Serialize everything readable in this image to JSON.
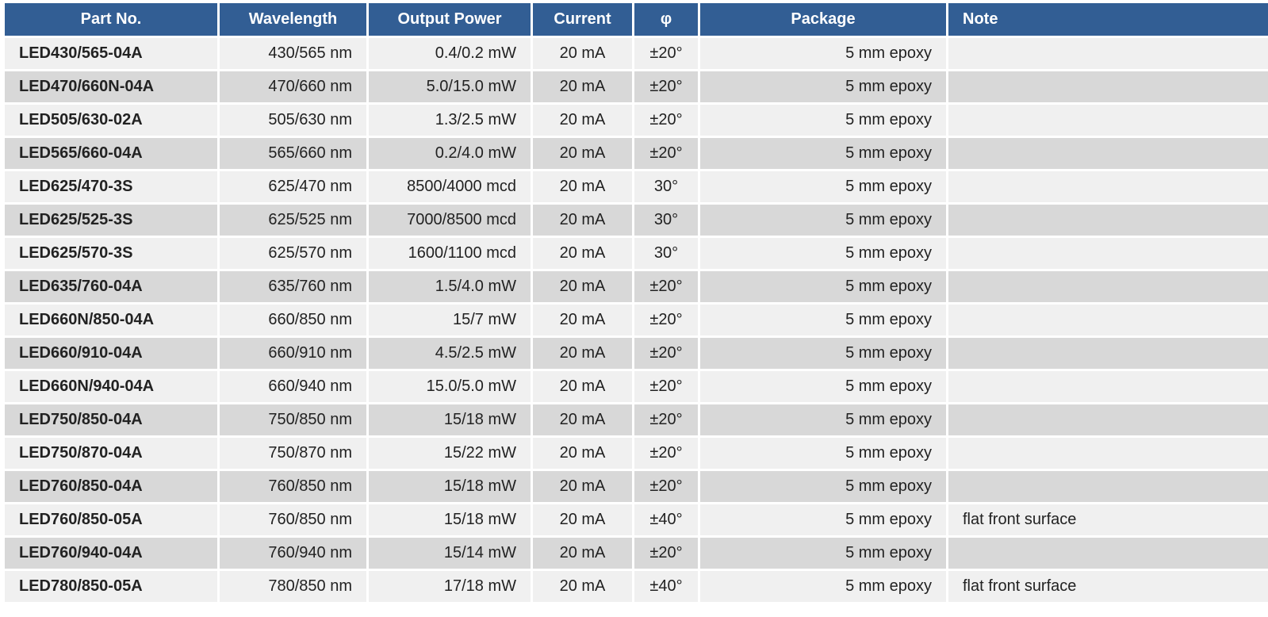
{
  "table": {
    "headers": {
      "part": "Part No.",
      "wavelength": "Wavelength",
      "output_power": "Output Power",
      "current": "Current",
      "phi": "φ",
      "package": "Package",
      "note": "Note"
    },
    "rows": [
      {
        "part": "LED430/565-04A",
        "wavelength": "430/565 nm",
        "output_power": "0.4/0.2 mW",
        "current": "20 mA",
        "phi": "±20°",
        "package": "5 mm epoxy",
        "note": ""
      },
      {
        "part": "LED470/660N-04A",
        "wavelength": "470/660 nm",
        "output_power": "5.0/15.0 mW",
        "current": "20 mA",
        "phi": "±20°",
        "package": "5 mm epoxy",
        "note": ""
      },
      {
        "part": "LED505/630-02A",
        "wavelength": "505/630 nm",
        "output_power": "1.3/2.5 mW",
        "current": "20 mA",
        "phi": "±20°",
        "package": "5 mm epoxy",
        "note": ""
      },
      {
        "part": "LED565/660-04A",
        "wavelength": "565/660 nm",
        "output_power": "0.2/4.0 mW",
        "current": "20 mA",
        "phi": "±20°",
        "package": "5 mm epoxy",
        "note": ""
      },
      {
        "part": "LED625/470-3S",
        "wavelength": "625/470 nm",
        "output_power": "8500/4000 mcd",
        "current": "20 mA",
        "phi": "30°",
        "package": "5 mm epoxy",
        "note": ""
      },
      {
        "part": "LED625/525-3S",
        "wavelength": "625/525 nm",
        "output_power": "7000/8500 mcd",
        "current": "20 mA",
        "phi": "30°",
        "package": "5 mm epoxy",
        "note": ""
      },
      {
        "part": "LED625/570-3S",
        "wavelength": "625/570 nm",
        "output_power": "1600/1100 mcd",
        "current": "20 mA",
        "phi": "30°",
        "package": "5 mm epoxy",
        "note": ""
      },
      {
        "part": "LED635/760-04A",
        "wavelength": "635/760 nm",
        "output_power": "1.5/4.0 mW",
        "current": "20 mA",
        "phi": "±20°",
        "package": "5 mm epoxy",
        "note": ""
      },
      {
        "part": "LED660N/850-04A",
        "wavelength": "660/850 nm",
        "output_power": "15/7 mW",
        "current": "20 mA",
        "phi": "±20°",
        "package": "5 mm epoxy",
        "note": ""
      },
      {
        "part": "LED660/910-04A",
        "wavelength": "660/910 nm",
        "output_power": "4.5/2.5 mW",
        "current": "20 mA",
        "phi": "±20°",
        "package": "5 mm epoxy",
        "note": ""
      },
      {
        "part": "LED660N/940-04A",
        "wavelength": "660/940 nm",
        "output_power": "15.0/5.0 mW",
        "current": "20 mA",
        "phi": "±20°",
        "package": "5 mm epoxy",
        "note": ""
      },
      {
        "part": "LED750/850-04A",
        "wavelength": "750/850 nm",
        "output_power": "15/18 mW",
        "current": "20 mA",
        "phi": "±20°",
        "package": "5 mm epoxy",
        "note": ""
      },
      {
        "part": "LED750/870-04A",
        "wavelength": "750/870 nm",
        "output_power": "15/22 mW",
        "current": "20 mA",
        "phi": "±20°",
        "package": "5 mm epoxy",
        "note": ""
      },
      {
        "part": "LED760/850-04A",
        "wavelength": "760/850 nm",
        "output_power": "15/18 mW",
        "current": "20 mA",
        "phi": "±20°",
        "package": "5 mm epoxy",
        "note": ""
      },
      {
        "part": "LED760/850-05A",
        "wavelength": "760/850 nm",
        "output_power": "15/18 mW",
        "current": "20 mA",
        "phi": "±40°",
        "package": "5 mm epoxy",
        "note": "flat front surface"
      },
      {
        "part": "LED760/940-04A",
        "wavelength": "760/940 nm",
        "output_power": "15/14 mW",
        "current": "20 mA",
        "phi": "±20°",
        "package": "5 mm epoxy",
        "note": ""
      },
      {
        "part": "LED780/850-05A",
        "wavelength": "780/850 nm",
        "output_power": "17/18 mW",
        "current": "20 mA",
        "phi": "±40°",
        "package": "5 mm epoxy",
        "note": "flat front surface"
      }
    ]
  },
  "colors": {
    "header_bg": "#325e94",
    "header_text": "#ffffff",
    "row_light": "#f0f0f0",
    "row_dark": "#d8d8d8"
  }
}
